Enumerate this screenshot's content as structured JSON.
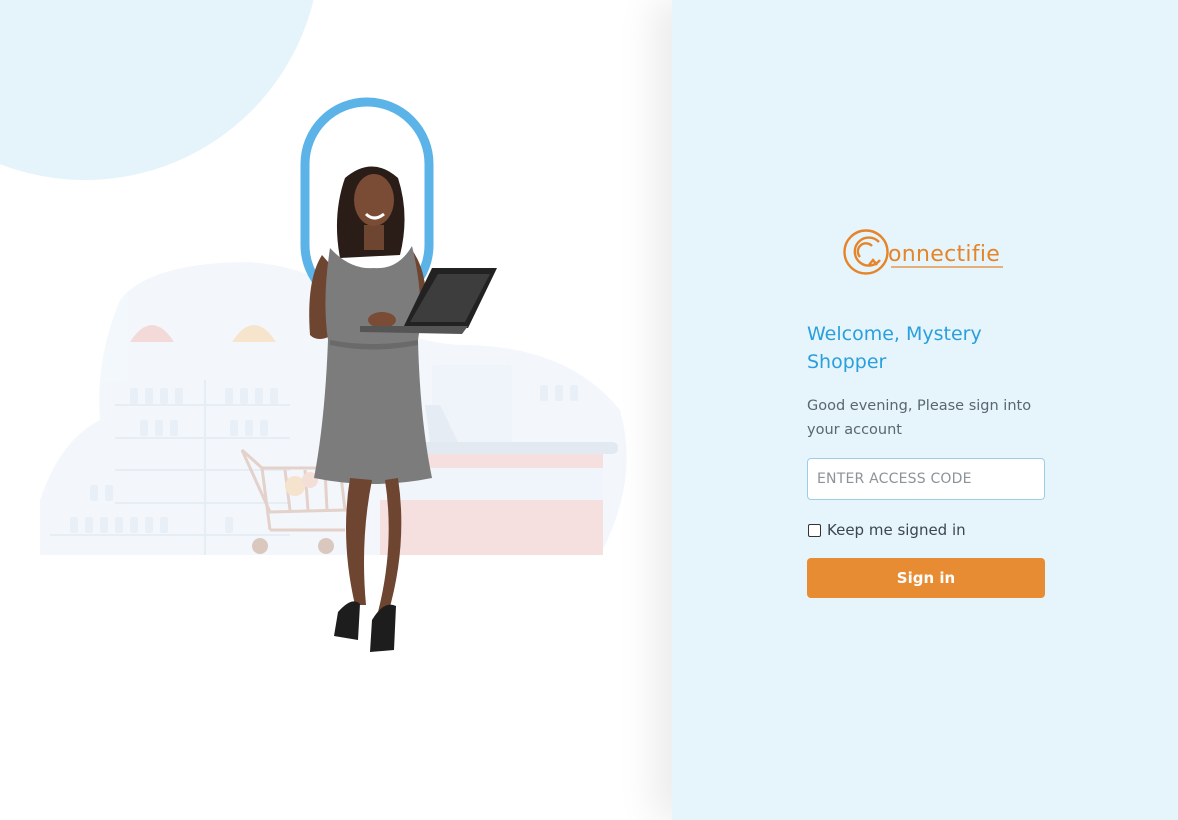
{
  "brand": {
    "name": "Connectifie",
    "wordmark": "onnectifie",
    "logo_icon": "circular-arrow-c-icon",
    "color": "#e5852a"
  },
  "login": {
    "title": "Welcome, Mystery Shopper",
    "subtitle": "Good evening, Please sign into your account",
    "access_code_placeholder": "ENTER ACCESS CODE",
    "access_code_value": "",
    "remember_label": "Keep me signed in",
    "remember_checked": false,
    "signin_label": "Sign in"
  },
  "colors": {
    "accent_blue": "#2a9fdd",
    "panel_background": "#e6f4fb",
    "button_orange": "#e88c33"
  },
  "illustration": {
    "subject": "woman-with-laptop",
    "scene": "supermarket-checkout-with-shopping-cart"
  }
}
